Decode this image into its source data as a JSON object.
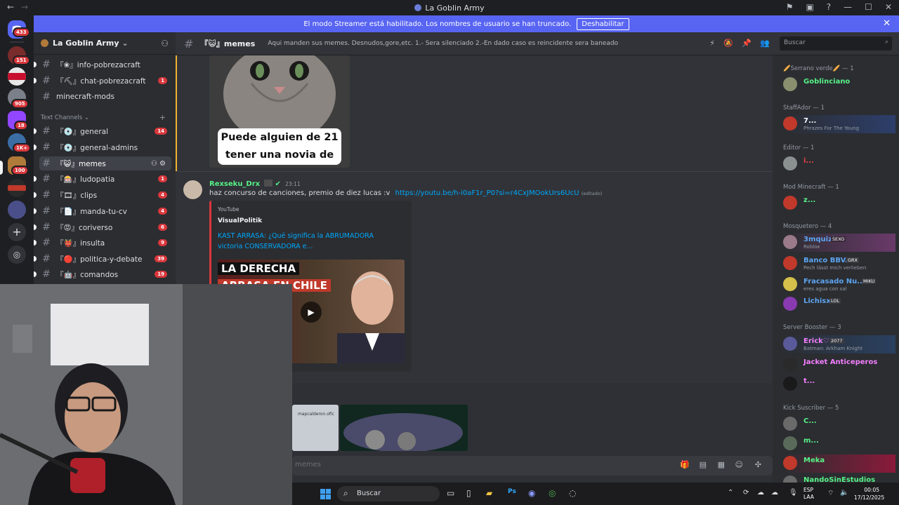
{
  "window": {
    "title": "La Goblin Army",
    "back": "←",
    "forward": "→"
  },
  "banner": {
    "text": "El modo Streamer está habilitado. Los nombres de usuario se han truncado.",
    "button": "Deshabilitar",
    "close": "✕"
  },
  "rail": {
    "badges": [
      "433",
      "151",
      "905",
      "18",
      "1K+",
      "100"
    ]
  },
  "guild": {
    "name": "La Goblin Army"
  },
  "channels_top": [
    {
      "label": "『❀』info-pobrezacraft",
      "count": ""
    },
    {
      "label": "『⛏』chat-pobrezacraft",
      "count": "1"
    },
    {
      "label": "minecraft-mods",
      "count": ""
    }
  ],
  "category": "Text Channels",
  "channels": [
    {
      "label": "『💿』general",
      "count": "14"
    },
    {
      "label": "『💿』general-admins",
      "count": ""
    },
    {
      "label": "『😺』memes",
      "count": ""
    },
    {
      "label": "『🎰』ludopatia",
      "count": "1"
    },
    {
      "label": "『🎞』clips",
      "count": "4"
    },
    {
      "label": "『📄』manda-tu-cv",
      "count": "4"
    },
    {
      "label": "『😡』coriverso",
      "count": "6"
    },
    {
      "label": "『👹』insulta",
      "count": "9"
    },
    {
      "label": "『🔴』politica-y-debate",
      "count": "39"
    },
    {
      "label": "『🤖』comandos",
      "count": "19"
    }
  ],
  "header": {
    "channel": "『😺』memes",
    "topic": "Aqui manden sus memes. Desnudos,gore,etc. 1.- Sera silenciado 2.-En dado caso es reincidente sera baneado",
    "search_placeholder": "Buscar"
  },
  "meme": {
    "caption": "Puede alguien de 21 tener una novia de 17?"
  },
  "message": {
    "author": "Rexseku_Drx",
    "time": "23:11",
    "text": "haz concurso de canciones, premio de diez lucas :v",
    "link": "https://youtu.be/h-i0aF1r_P0?si=r4CxJMOokUrs6UcU",
    "edited": "(editado)"
  },
  "embed": {
    "provider": "YouTube",
    "author": "VisualPolitik",
    "title": "KAST ARRASA: ¿Qué significa la ABRUMADORA victoria CONSERVADORA e...",
    "thumb_line1": "LA DERECHA",
    "thumb_line2": "ARRASA EN CHILE"
  },
  "attachment": {
    "watermark": "mapcalderon.ofic"
  },
  "composer": {
    "placeholder": "memes"
  },
  "members": {
    "categories": [
      "🥖Serrano verde🥖 — 1",
      "StaffAdor — 1",
      "Editor — 1",
      "Mod Minecraft — 1",
      "Mosquetero — 4",
      "Server Booster — 3",
      "Kick Suscriber — 5"
    ],
    "list": [
      {
        "name": "Goblinciano",
        "status": "",
        "tag": "",
        "color": "#57f287"
      },
      {
        "name": "7...",
        "status": "Phrazes For The Young",
        "tag": "",
        "color": "#ffffff"
      },
      {
        "name": "i...",
        "status": "",
        "tag": "",
        "color": "#ed4245"
      },
      {
        "name": "z...",
        "status": "",
        "tag": "",
        "color": "#57f287"
      },
      {
        "name": "3mquizi",
        "status": "Roblox",
        "tag": "SEXO",
        "color": "#5da5f2"
      },
      {
        "name": "Banco BBVA",
        "status": "Pech lässt mich verlieben",
        "tag": "GRX",
        "color": "#5da5f2"
      },
      {
        "name": "Fracasado Nu...",
        "status": "eres agua con sal",
        "tag": "MIKU",
        "color": "#5da5f2"
      },
      {
        "name": "Lichisx",
        "status": "",
        "tag": "LOL",
        "color": "#5da5f2"
      },
      {
        "name": "Erick♡",
        "status": "Batman: Arkham Knight",
        "tag": "2077",
        "color": "#f47fff"
      },
      {
        "name": "Jacket Anticeperos",
        "status": "",
        "tag": "",
        "color": "#f47fff"
      },
      {
        "name": "t...",
        "status": "",
        "tag": "",
        "color": "#f47fff"
      },
      {
        "name": "C...",
        "status": "",
        "tag": "",
        "color": "#57f287"
      },
      {
        "name": "m...",
        "status": "",
        "tag": "",
        "color": "#57f287"
      },
      {
        "name": "Meka",
        "status": "",
        "tag": "",
        "color": "#57f287"
      },
      {
        "name": "NandoSinEstudios",
        "status": "",
        "tag": "",
        "color": "#57f287"
      }
    ]
  },
  "taskbar": {
    "search": "Buscar",
    "lang1": "ESP",
    "lang2": "LAA",
    "time": "00:05",
    "date": "17/12/2025"
  },
  "colors": {
    "accent": "#5865f2",
    "danger": "#da373c",
    "link": "#00a8fc"
  }
}
